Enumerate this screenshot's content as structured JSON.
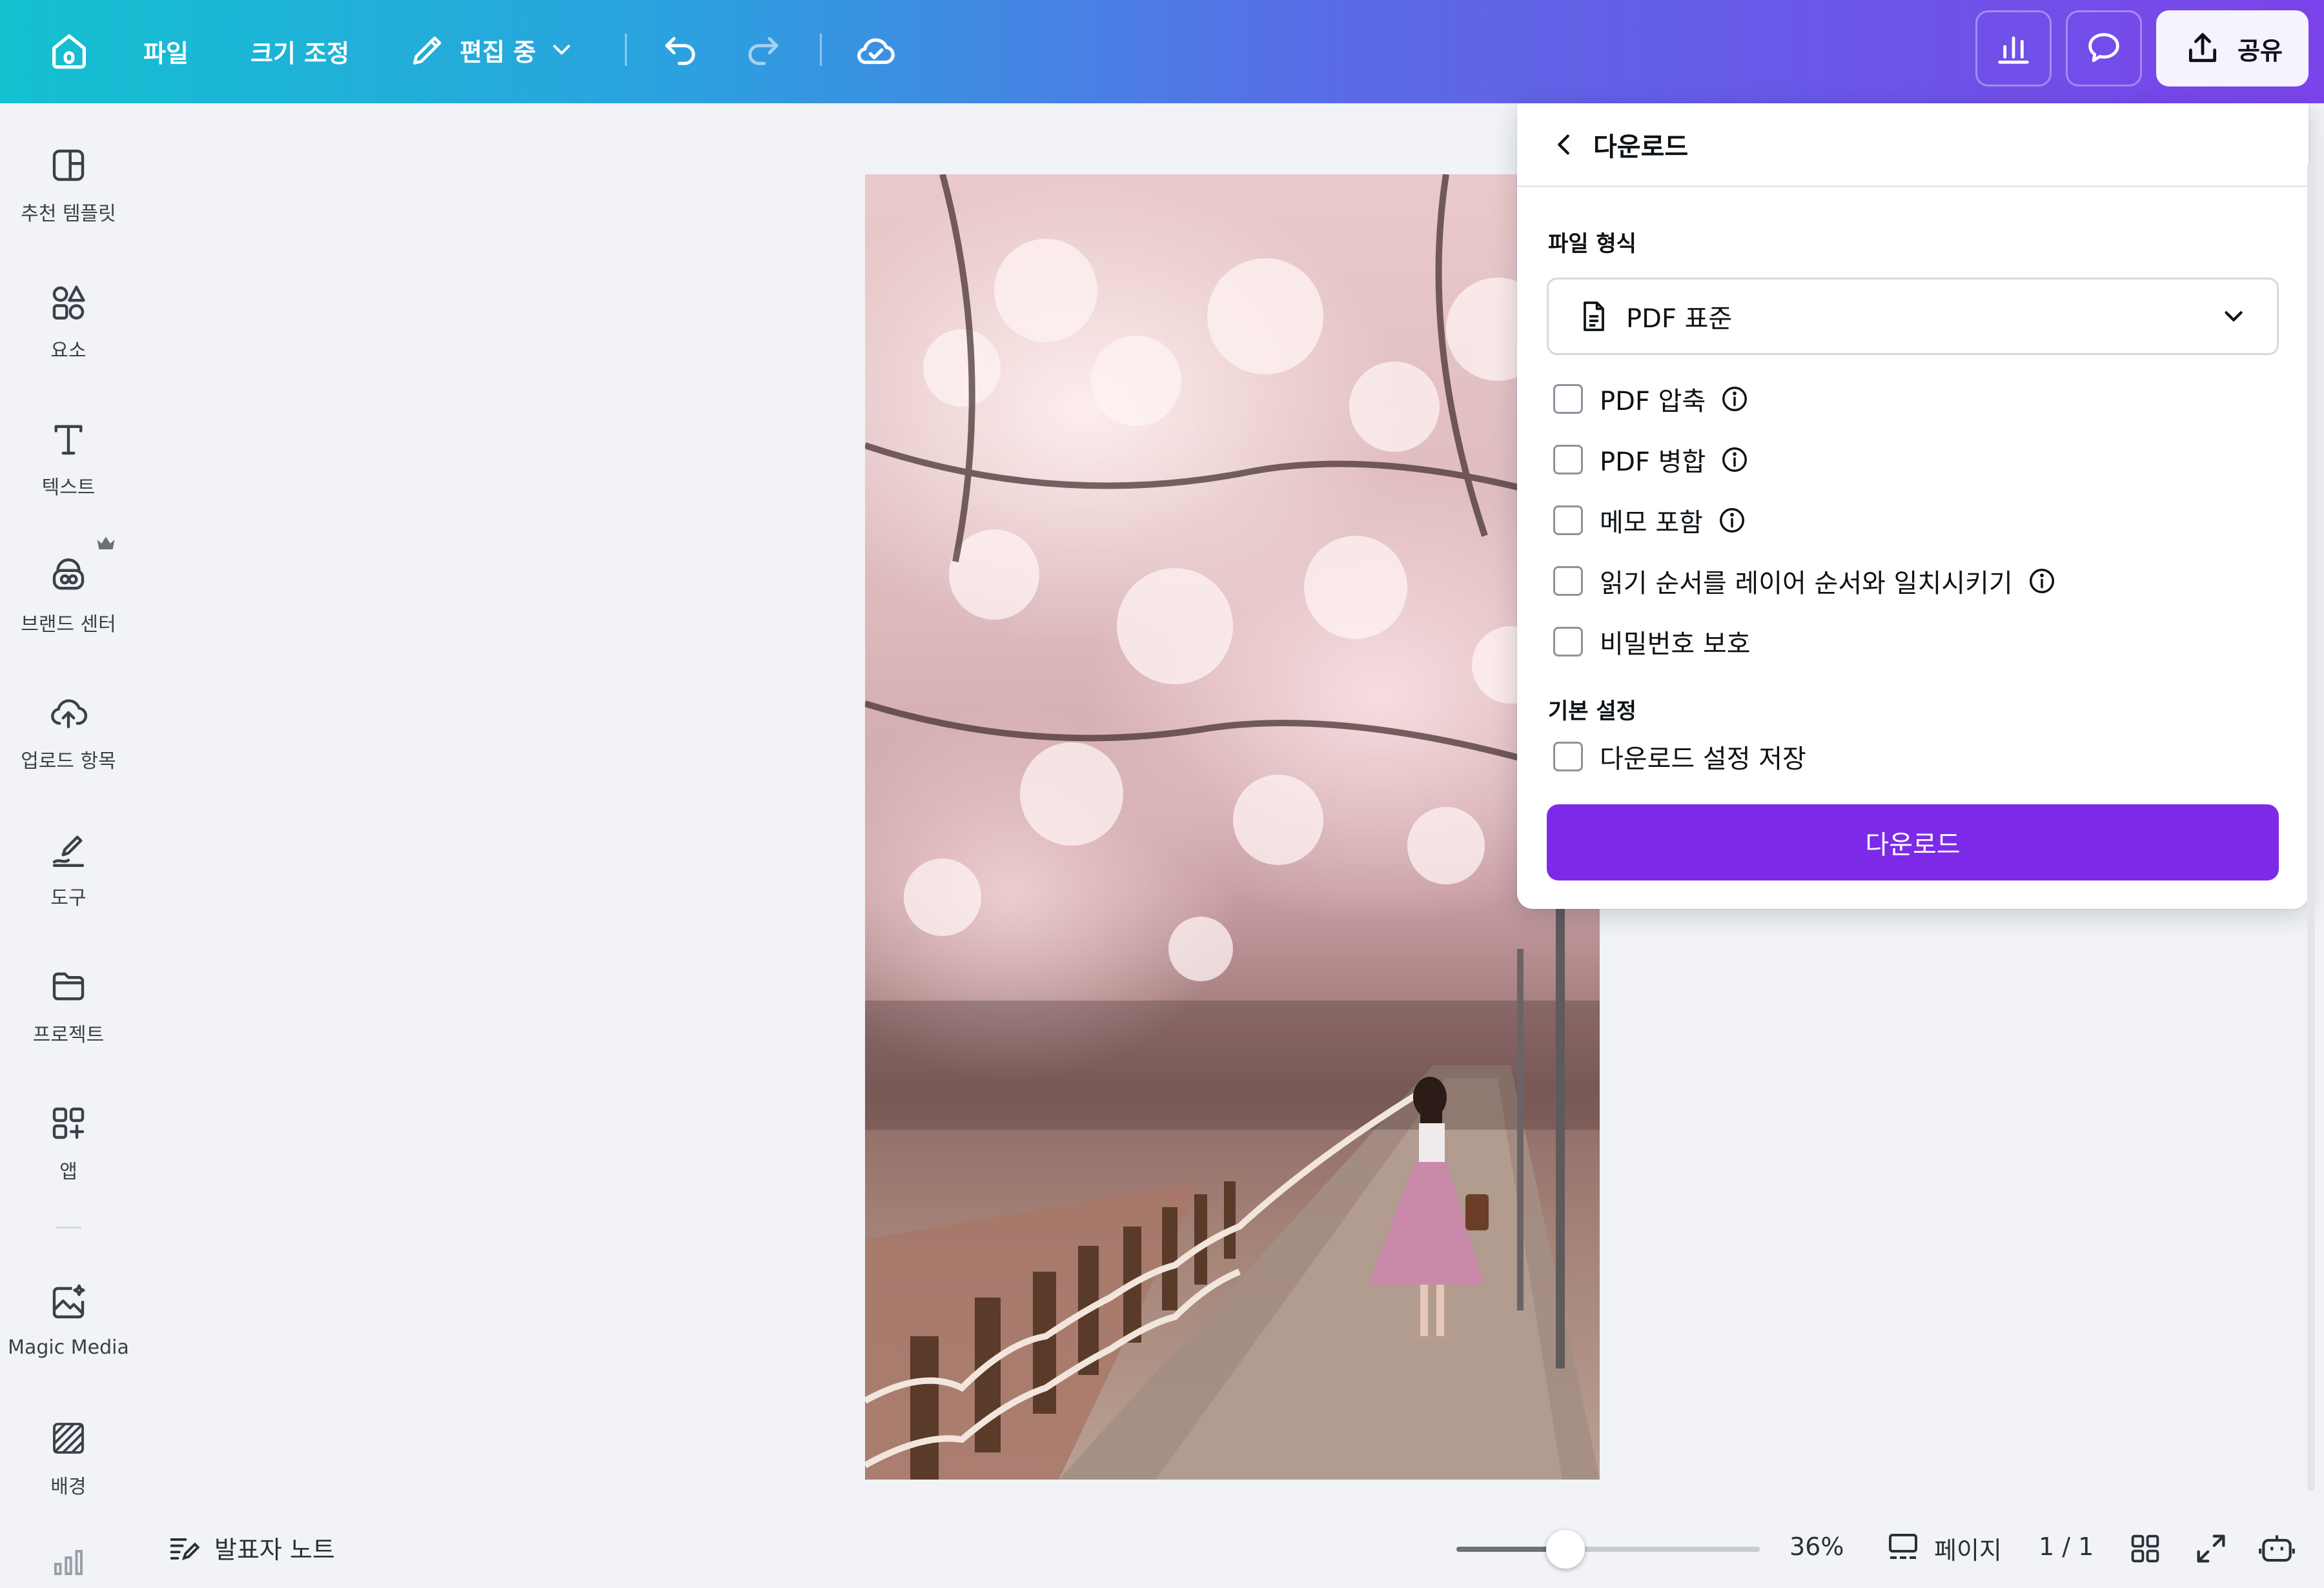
{
  "toolbar": {
    "file_label": "파일",
    "resize_label": "크기 조정",
    "editing_label": "편집 중",
    "share_label": "공유"
  },
  "sidebar": {
    "items": [
      {
        "label": "추천 템플릿",
        "icon": "template-icon"
      },
      {
        "label": "요소",
        "icon": "elements-icon"
      },
      {
        "label": "텍스트",
        "icon": "text-icon"
      },
      {
        "label": "브랜드 센터",
        "icon": "brand-icon"
      },
      {
        "label": "업로드 항목",
        "icon": "upload-icon"
      },
      {
        "label": "도구",
        "icon": "draw-icon"
      },
      {
        "label": "프로젝트",
        "icon": "folder-icon"
      },
      {
        "label": "앱",
        "icon": "apps-icon"
      },
      {
        "label": "Magic Media",
        "icon": "magic-media-icon"
      },
      {
        "label": "배경",
        "icon": "background-icon"
      }
    ]
  },
  "download_panel": {
    "title": "다운로드",
    "file_type_label": "파일 형식",
    "file_type_value": "PDF 표준",
    "options": [
      {
        "label": "PDF 압축",
        "checked": false,
        "info": true
      },
      {
        "label": "PDF 병합",
        "checked": false,
        "info": true
      },
      {
        "label": "메모 포함",
        "checked": false,
        "info": true
      },
      {
        "label": "읽기 순서를 레이어 순서와 일치시키기",
        "checked": false,
        "info": true
      },
      {
        "label": "비밀번호 보호",
        "checked": false,
        "info": false
      }
    ],
    "preferences_label": "기본 설정",
    "save_settings_label": "다운로드 설정 저장",
    "download_button": "다운로드"
  },
  "bottom_bar": {
    "notes_label": "발표자 노트",
    "zoom_label": "36%",
    "zoom_value": 0.36,
    "pages_label": "페이지",
    "page_count": "1 / 1"
  },
  "colors": {
    "accent": "#7d2ae8",
    "toolbar_start": "#13c0cf",
    "toolbar_end": "#7b43ea"
  }
}
